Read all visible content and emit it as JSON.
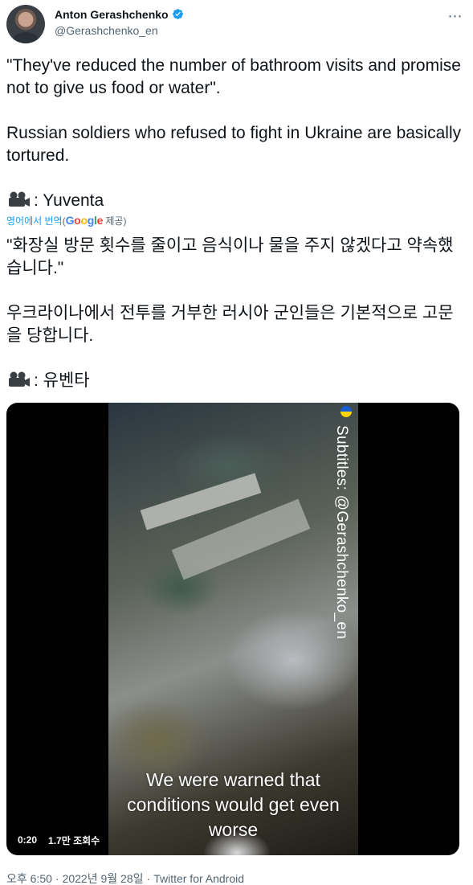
{
  "author": {
    "name": "Anton Gerashchenko",
    "handle": "@Gerashchenko_en",
    "verified_color": "#1d9bf0"
  },
  "more_icon": "⋯",
  "tweet": {
    "p1": "\"They've reduced the number of bathroom visits and promise not to give us food or water\".",
    "p2": " Russian soldiers who refused to fight in Ukraine are basically tortured.",
    "p3": ": Yuventa"
  },
  "translation": {
    "label": "영어에서 번역",
    "provider_open": "(",
    "provider_suffix": " 제공)",
    "google": [
      "G",
      "o",
      "o",
      "g",
      "l",
      "e"
    ],
    "kr1": "\"화장실 방문 횟수를 줄이고 음식이나 물을 주지 않겠다고 약속했습니다.\"",
    "kr2": "우크라이나에서 전투를 거부한 러시아 군인들은 기본적으로 고문을 당합니다.",
    "kr3": ": 유벤타"
  },
  "video": {
    "subtitle_credit": "Subtitles: @Gerashchenko_en",
    "caption": "We were warned that conditions would get even worse",
    "duration": "0:20",
    "views": "1.7만 조회수"
  },
  "meta": {
    "time": "오후 6:50",
    "separator": "·",
    "date": "2022년 9월 28일",
    "source": "Twitter for Android"
  }
}
